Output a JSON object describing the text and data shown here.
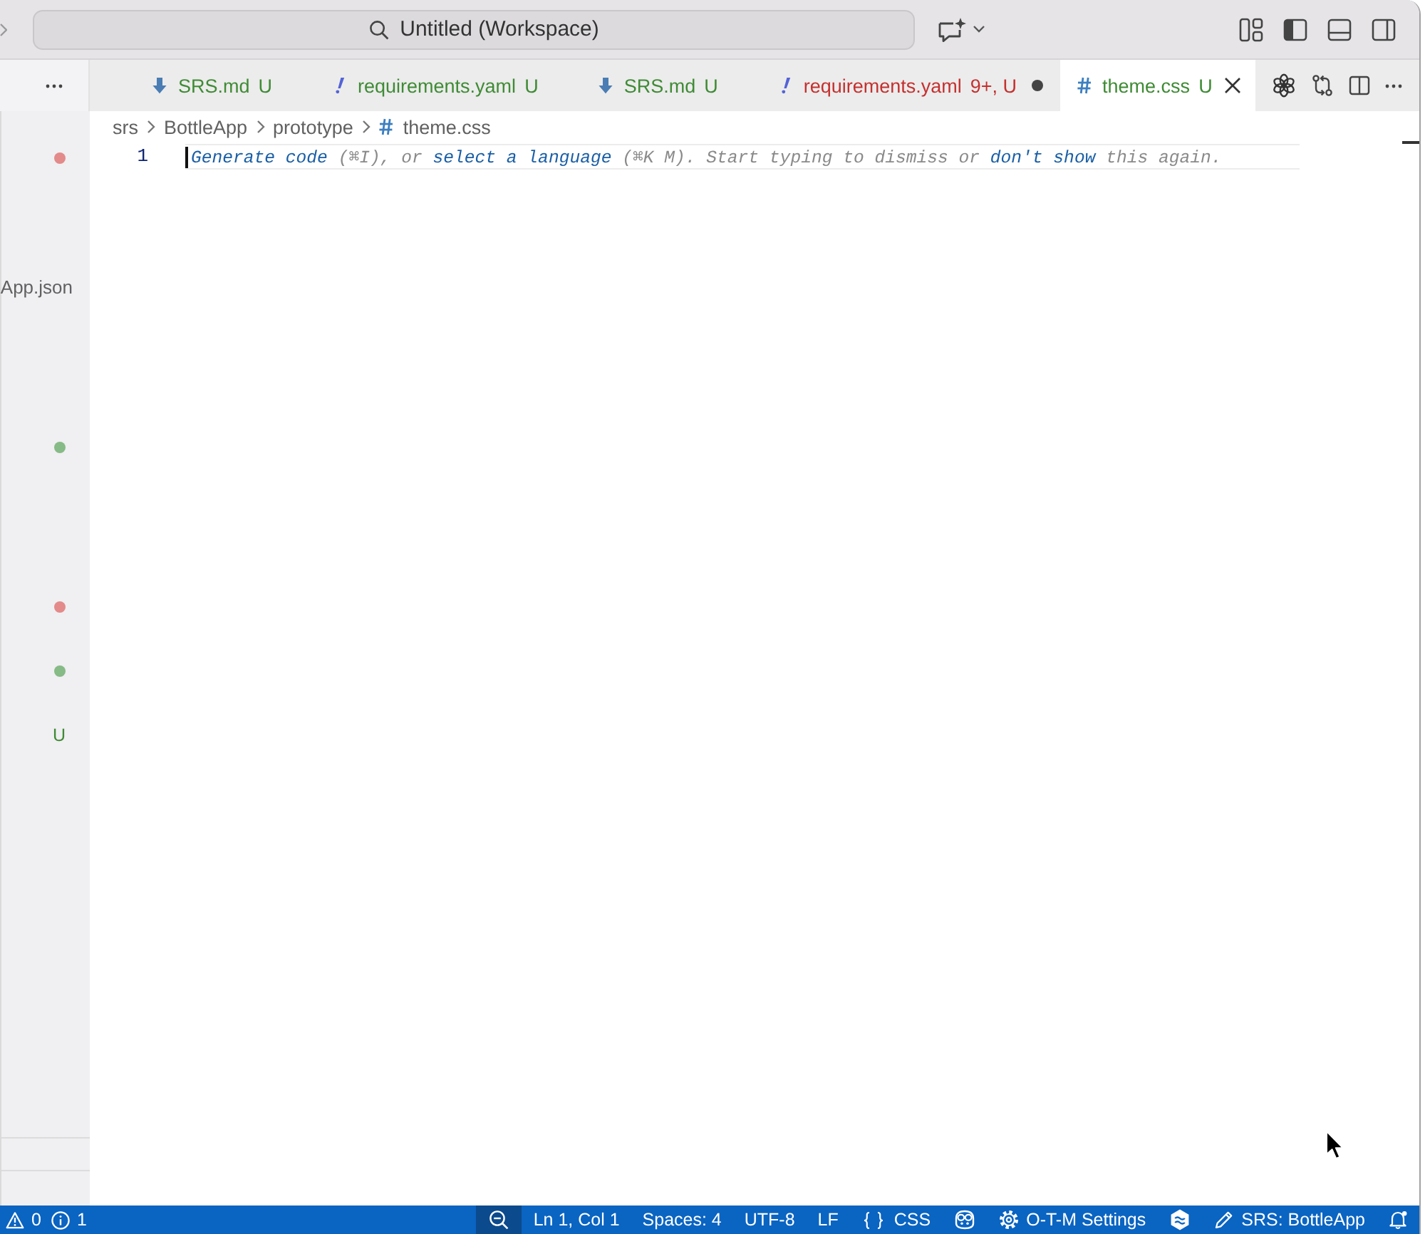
{
  "title_bar": {
    "command_center": "Untitled (Workspace)"
  },
  "tabs": [
    {
      "kind": "markdown",
      "label": "SRS.md",
      "decoration": "U",
      "error": false,
      "dirty": false,
      "selected": false
    },
    {
      "kind": "yaml",
      "label": "requirements.yaml",
      "decoration": "U",
      "error": false,
      "dirty": false,
      "selected": false
    },
    {
      "kind": "markdown",
      "label": "SRS.md",
      "decoration": "U",
      "error": false,
      "dirty": false,
      "selected": false
    },
    {
      "kind": "yaml",
      "label": "requirements.yaml",
      "decoration": "9+, U",
      "error": true,
      "dirty": true,
      "selected": false
    },
    {
      "kind": "css",
      "label": "theme.css",
      "decoration": "U",
      "error": false,
      "dirty": false,
      "selected": true
    }
  ],
  "breadcrumbs": [
    {
      "kind": "folder",
      "label": "srs"
    },
    {
      "kind": "folder",
      "label": "BottleApp"
    },
    {
      "kind": "folder",
      "label": "prototype"
    },
    {
      "kind": "css",
      "label": "theme.css"
    }
  ],
  "editor": {
    "lines": [
      {
        "number": "1",
        "active": true,
        "hint": [
          {
            "kind": "link",
            "text": "Generate code"
          },
          {
            "kind": "text",
            "text": " (⌘I), or "
          },
          {
            "kind": "link",
            "text": "select a language"
          },
          {
            "kind": "text",
            "text": " (⌘K M). Start typing to dismiss or "
          },
          {
            "kind": "link",
            "text": "don't show"
          },
          {
            "kind": "text",
            "text": " this again."
          }
        ]
      }
    ]
  },
  "sidebar": {
    "rows": [
      {
        "kind": "dot",
        "color": "#e38a8a"
      },
      {
        "kind": "blank"
      },
      {
        "kind": "blank"
      },
      {
        "kind": "blank"
      },
      {
        "kind": "label",
        "text": "App.json"
      },
      {
        "kind": "blank"
      },
      {
        "kind": "blank"
      },
      {
        "kind": "blank"
      },
      {
        "kind": "blank"
      },
      {
        "kind": "dot",
        "color": "#86ba86"
      },
      {
        "kind": "blank"
      },
      {
        "kind": "blank"
      },
      {
        "kind": "blank"
      },
      {
        "kind": "blank"
      },
      {
        "kind": "dot",
        "color": "#e38a8a"
      },
      {
        "kind": "blank"
      },
      {
        "kind": "dot",
        "color": "#86ba86"
      },
      {
        "kind": "blank"
      },
      {
        "kind": "letter",
        "text": "U",
        "color": "#3f8b35"
      }
    ]
  },
  "status_bar": {
    "left": [
      {
        "kind": "warnings",
        "text": "0"
      },
      {
        "kind": "infos",
        "text": "1"
      }
    ],
    "right": [
      {
        "kind": "zoom"
      },
      {
        "kind": "cursor",
        "text": "Ln 1, Col 1"
      },
      {
        "kind": "indent",
        "text": "Spaces: 4"
      },
      {
        "kind": "encoding",
        "text": "UTF-8"
      },
      {
        "kind": "eol",
        "text": "LF"
      },
      {
        "kind": "language",
        "text": "CSS"
      },
      {
        "kind": "assistant"
      },
      {
        "kind": "settings",
        "text": "O-T-M Settings"
      },
      {
        "kind": "extension"
      },
      {
        "kind": "mode",
        "text": "SRS: BottleApp"
      },
      {
        "kind": "notifications"
      }
    ]
  }
}
